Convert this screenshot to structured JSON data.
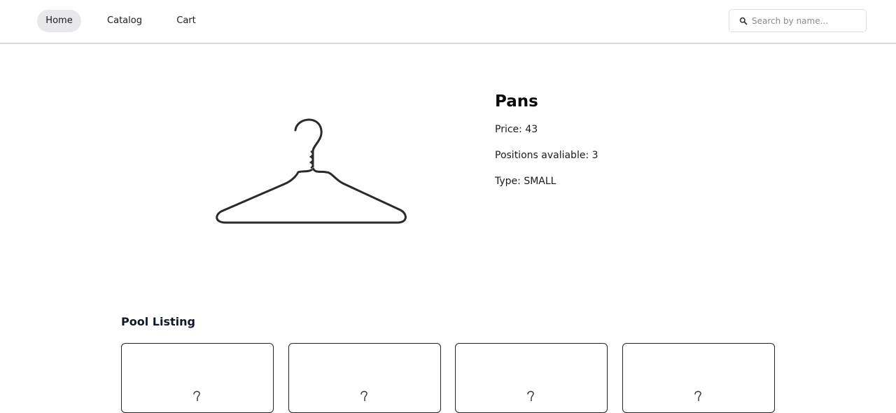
{
  "nav": {
    "items": [
      {
        "label": "Home",
        "active": true
      },
      {
        "label": "Catalog",
        "active": false
      },
      {
        "label": "Cart",
        "active": false
      }
    ]
  },
  "search": {
    "placeholder": "Search by name...",
    "value": "",
    "icon": "search-icon"
  },
  "product": {
    "title": "Pans",
    "price_line": "Price: 43",
    "positions_line": "Positions avaliable: 3",
    "type_line": "Type: SMALL",
    "image_icon": "hanger-icon"
  },
  "pool": {
    "title": "Pool Listing",
    "cards": [
      {
        "icon": "hanger-icon"
      },
      {
        "icon": "hanger-icon"
      },
      {
        "icon": "hanger-icon"
      },
      {
        "icon": "hanger-icon"
      }
    ]
  },
  "colors": {
    "nav_active_bg": "#e8e8ea",
    "divider": "#d9d9d9",
    "card_border": "#222222"
  }
}
